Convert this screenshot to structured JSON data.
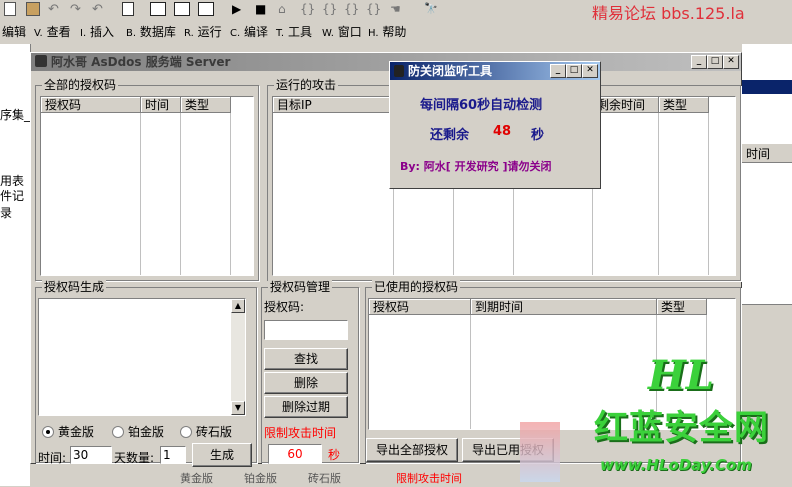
{
  "ide": {
    "forum": "精易论坛 bbs.125.la",
    "menu": [
      "编辑",
      "查看",
      "插入",
      "数据库",
      "运行",
      "编译",
      "工具",
      "窗口",
      "帮助"
    ],
    "menu_keys": [
      "",
      "V.",
      "I.",
      "B.",
      "R.",
      "C.",
      "T.",
      "W.",
      "H."
    ],
    "left_fragments": [
      "序集_",
      "用表",
      "件记录"
    ],
    "right_fragment": "时间"
  },
  "main_window": {
    "title": "阿水哥 AsDdos 服务端 Server",
    "all_codes": {
      "legend": "全部的授权码",
      "columns": [
        "授权码",
        "时间",
        "类型"
      ]
    },
    "running": {
      "legend": "运行的攻击",
      "columns": [
        "目标IP",
        "剩余时间",
        "类型"
      ]
    },
    "generate": {
      "legend": "授权码生成",
      "editions": [
        "黄金版",
        "铂金版",
        "砖石版"
      ],
      "selected_edition": "黄金版",
      "time_label": "时间:",
      "time_value": "30",
      "days_label": "天数量:",
      "days_value": "1",
      "generate_button": "生成"
    },
    "manage": {
      "legend": "授权码管理",
      "code_label": "授权码:",
      "code_value": "",
      "find_button": "查找",
      "delete_button": "删除",
      "delete_expired_button": "删除过期",
      "limit_label": "限制攻击时间",
      "limit_value": "60",
      "limit_unit": "秒"
    },
    "used": {
      "legend": "已使用的授权码",
      "columns": [
        "授权码",
        "到期时间",
        "类型"
      ],
      "export_all_button": "导出全部授权",
      "export_used_button": "导出已用授权"
    },
    "bottom_strip": {
      "editions": [
        "黄金版",
        "铂金版",
        "砖石版"
      ],
      "limit_label": "限制攻击时间"
    }
  },
  "popup": {
    "title": "防关闭监听工具",
    "line1": "每间隔60秒自动检测",
    "remaining_label": "还剩余",
    "remaining_value": "48",
    "remaining_unit": "秒",
    "footer": "By: 阿水[ 开发研究 ]请勿关闭"
  },
  "watermark": {
    "logo": "HL",
    "name": "红蓝安全网",
    "url": "www.HLoDay.Com"
  },
  "colors": {
    "title_active": "#0a246a",
    "popup_text": "#1a1a8c",
    "countdown": "#e00000",
    "footer": "#8b008b",
    "limit_red": "#ff0000",
    "forum_red": "#e0303a",
    "watermark_green": "#3bd13b"
  }
}
